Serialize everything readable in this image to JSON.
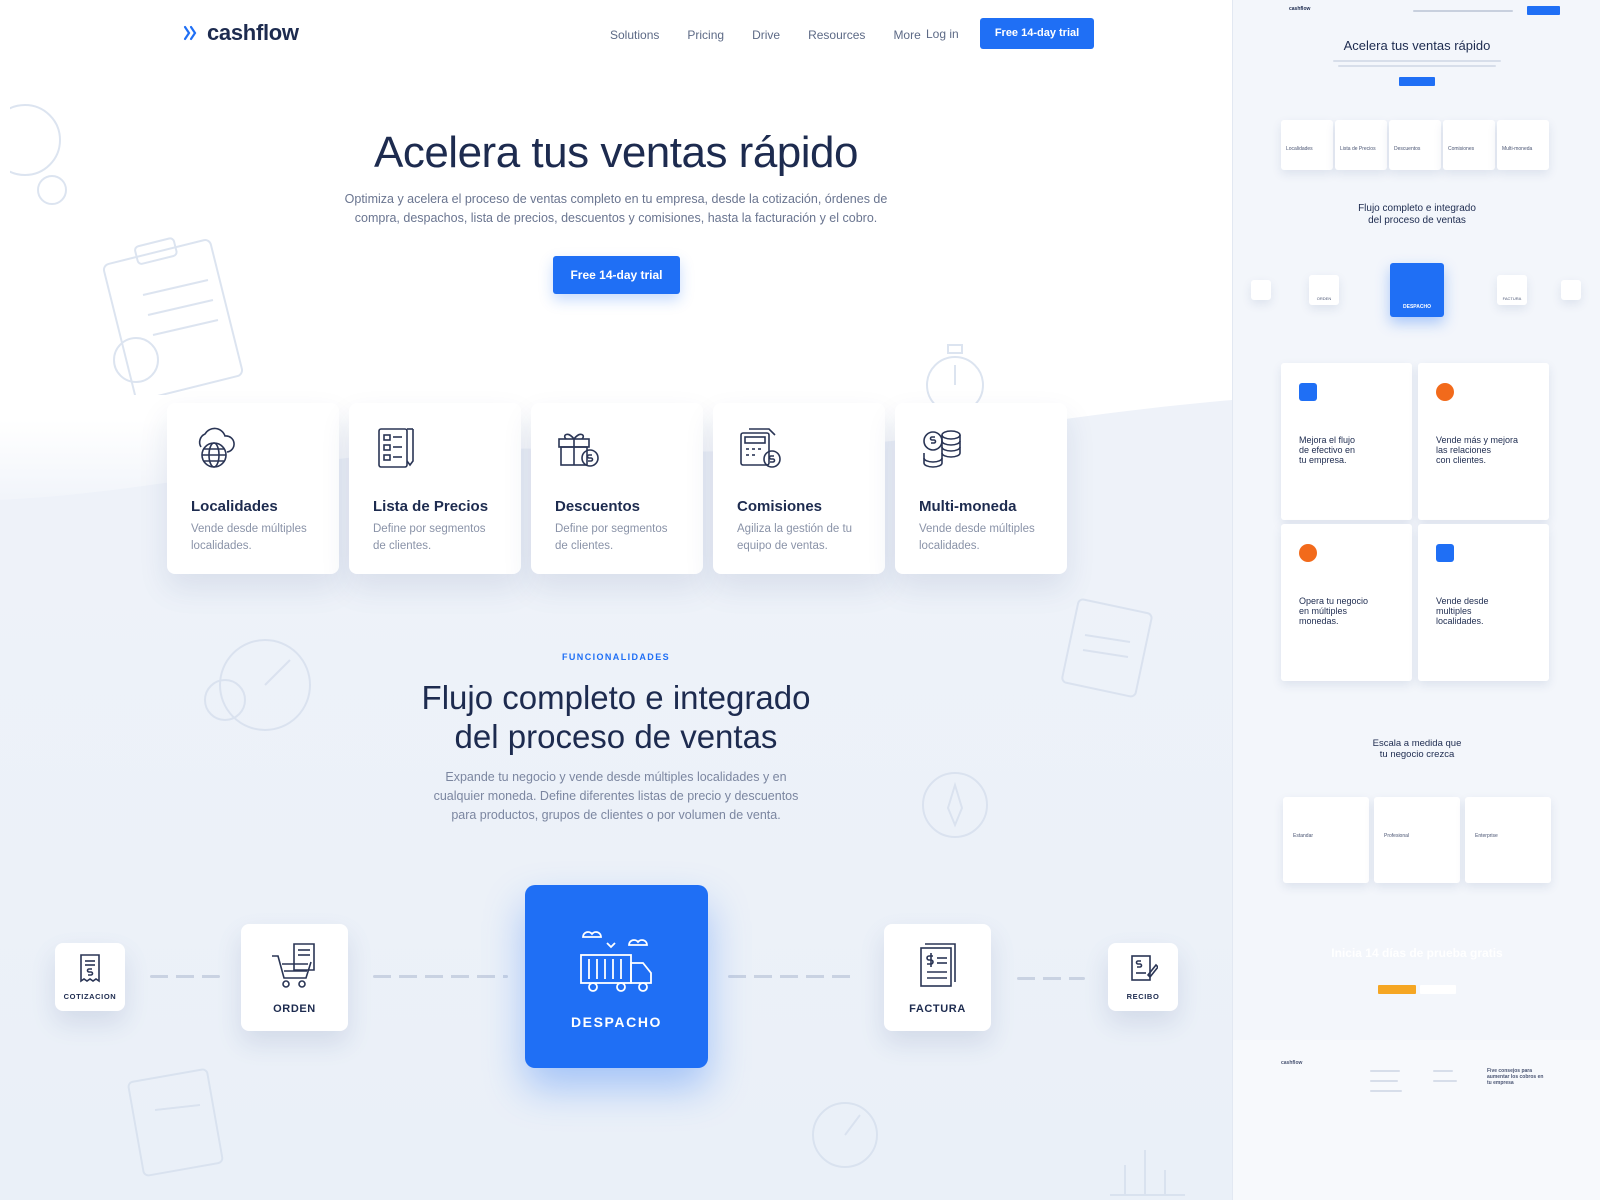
{
  "nav": {
    "logo": "cashflow",
    "items": [
      "Solutions",
      "Pricing",
      "Drive",
      "Resources",
      "More"
    ],
    "login": "Log in",
    "cta": "Free 14-day trial"
  },
  "hero": {
    "title": "Acelera tus ventas rápido",
    "subtitle": "Optimiza y acelera el proceso de ventas completo en tu empresa, desde la cotización, órdenes de compra, despachos, lista de precios, descuentos y comisiones, hasta la facturación y el cobro.",
    "cta": "Free 14-day trial"
  },
  "features": [
    {
      "title": "Localidades",
      "desc": "Vende desde múltiples localidades.",
      "icon": "globe-cloud-icon"
    },
    {
      "title": "Lista de Precios",
      "desc": "Define por segmentos de clientes.",
      "icon": "price-list-icon"
    },
    {
      "title": "Descuentos",
      "desc": "Define por segmentos de clientes.",
      "icon": "gift-dollar-icon"
    },
    {
      "title": "Comisiones",
      "desc": "Agiliza la gestión de tu equipo de ventas.",
      "icon": "calculator-dollar-icon"
    },
    {
      "title": "Multi-moneda",
      "desc": "Vende desde múltiples localidades.",
      "icon": "coins-icon"
    }
  ],
  "section": {
    "eyebrow": "FUNCIONALIDADES",
    "title_line1": "Flujo completo e integrado",
    "title_line2": "del proceso de ventas",
    "subtitle": "Expande tu negocio y vende desde múltiples localidades y en cualquier moneda. Define diferentes listas de precio y descuentos para productos, grupos de clientes o por volumen de venta."
  },
  "flow": {
    "cotizacion": "COTIZACION",
    "orden": "ORDEN",
    "despacho": "DESPACHO",
    "factura": "FACTURA",
    "recibo": "RECIBO"
  },
  "preview": {
    "hero_title": "Acelera tus ventas rápido",
    "cta": "Free 14-day trial",
    "features": [
      "Localidades",
      "Lista de Precios",
      "Descuentos",
      "Comisiones",
      "Multi-moneda"
    ],
    "section_title_1": "Flujo completo e integrado",
    "section_title_2": "del proceso de ventas",
    "flow_main": "DESPACHO",
    "flow_orden": "ORDEN",
    "flow_factura": "FACTURA",
    "benefits": [
      {
        "l1": "Mejora el flujo",
        "l2": "de efectivo en",
        "l3": "tu empresa.",
        "color": "#1f6ff5"
      },
      {
        "l1": "Vende más y mejora",
        "l2": "las relaciones",
        "l3": "con clientes.",
        "color": "#f26a1b"
      },
      {
        "l1": "Opera tu negocio",
        "l2": "en múltiples",
        "l3": "monedas.",
        "color": "#f26a1b"
      },
      {
        "l1": "Vende desde",
        "l2": "multiples",
        "l3": "localidades.",
        "color": "#1f6ff5"
      }
    ],
    "scale_title_1": "Escala a medida que",
    "scale_title_2": "tu negocio crezca",
    "plans": [
      "Estandar",
      "Profesional",
      "Enterprise"
    ],
    "cta_title": "Inicia 14 días de prueba gratis",
    "footer_logo": "cashflow",
    "footer_heading": "Five consejos para aumentar los cobros en tu empresa"
  },
  "colors": {
    "accent": "#1f6ff5",
    "orange": "#f26a1b",
    "text": "#1d2b4f"
  }
}
